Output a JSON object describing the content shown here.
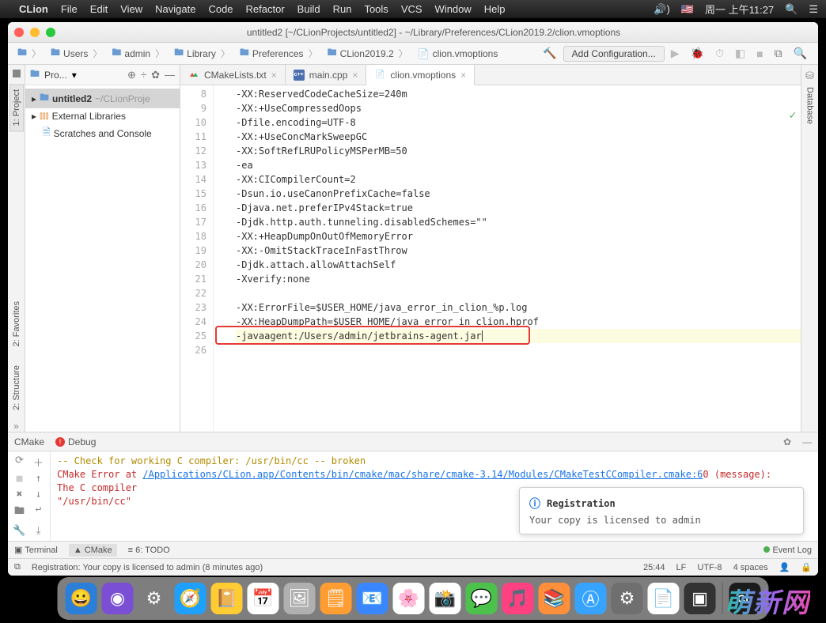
{
  "menubar": {
    "app": "CLion",
    "items": [
      "File",
      "Edit",
      "View",
      "Navigate",
      "Code",
      "Refactor",
      "Build",
      "Run",
      "Tools",
      "VCS",
      "Window",
      "Help"
    ],
    "clock": "周一 上午11:27"
  },
  "window": {
    "title": "untitled2 [~/CLionProjects/untitled2] - ~/Library/Preferences/CLion2019.2/clion.vmoptions"
  },
  "breadcrumbs": [
    "Users",
    "admin",
    "Library",
    "Preferences",
    "CLion2019.2",
    "clion.vmoptions"
  ],
  "toolbar": {
    "add_config": "Add Configuration..."
  },
  "project_pane": {
    "title": "Pro...",
    "items": [
      {
        "name": "untitled2",
        "path": "~/CLionProje",
        "selected": true
      },
      {
        "name": "External Libraries"
      },
      {
        "name": "Scratches and Console"
      }
    ]
  },
  "left_vtabs": [
    "1: Project",
    "2: Favorites",
    "2: Structure"
  ],
  "right_vtabs": [
    "Database"
  ],
  "editor_tabs": [
    {
      "label": "CMakeLists.txt",
      "icon_color": "multi"
    },
    {
      "label": "main.cpp",
      "icon_text": "c++",
      "icon_color": "#4b6eaf"
    },
    {
      "label": "clion.vmoptions",
      "active": true,
      "icon_color": "#888"
    }
  ],
  "editor": {
    "first_line_no": 8,
    "lines": [
      "-XX:ReservedCodeCacheSize=240m",
      "-XX:+UseCompressedOops",
      "-Dfile.encoding=UTF-8",
      "-XX:+UseConcMarkSweepGC",
      "-XX:SoftRefLRUPolicyMSPerMB=50",
      "-ea",
      "-XX:CICompilerCount=2",
      "-Dsun.io.useCanonPrefixCache=false",
      "-Djava.net.preferIPv4Stack=true",
      "-Djdk.http.auth.tunneling.disabledSchemes=\"\"",
      "-XX:+HeapDumpOnOutOfMemoryError",
      "-XX:-OmitStackTraceInFastThrow",
      "-Djdk.attach.allowAttachSelf",
      "-Xverify:none",
      "",
      "-XX:ErrorFile=$USER_HOME/java_error_in_clion_%p.log",
      "-XX:HeapDumpPath=$USER_HOME/java_error_in_clion.hprof",
      "-javaagent:/Users/admin/jetbrains-agent.jar",
      ""
    ],
    "highlighted_line_index": 17
  },
  "cmake_panel": {
    "tabs": {
      "cmake": "CMake",
      "debug": "Debug"
    },
    "lines": [
      {
        "text": "-- Check for working C compiler: /usr/bin/cc -- broken",
        "color": "#b28b00"
      },
      {
        "prefix": "CMake Error at ",
        "prefix_color": "#c62828",
        "link": "/Applications/CLion.app/Contents/bin/cmake/mac/share/cmake-3.14/Modules/CMakeTestCCompiler.cmake:6",
        "suffix": "0 (message):"
      },
      {
        "text": "  The C compiler",
        "color": "#c62828"
      },
      {
        "text": ""
      },
      {
        "text": "    \"/usr/bin/cc\"",
        "color": "#c62828"
      }
    ],
    "popup": {
      "title": "Registration",
      "body": "Your copy is licensed to admin"
    }
  },
  "bottom_tabs": {
    "terminal": "Terminal",
    "cmake": "CMake",
    "todo": "6: TODO",
    "eventlog": "Event Log"
  },
  "status_bar": {
    "msg": "Registration: Your copy is licensed to admin (8 minutes ago)",
    "pos": "25:44",
    "eol": "LF",
    "enc": "UTF-8",
    "indent": "4 spaces"
  },
  "dock_apps": [
    {
      "bg": "#2b7fd9",
      "emoji": "😀"
    },
    {
      "bg": "#7a4fd4",
      "emoji": "◉"
    },
    {
      "bg": "#7e7e7e",
      "emoji": "⚙"
    },
    {
      "bg": "#1ea0ff",
      "emoji": "🧭"
    },
    {
      "bg": "#ffcc33",
      "emoji": "📔"
    },
    {
      "bg": "#fff",
      "emoji": "📅"
    },
    {
      "bg": "#b0b0b0",
      "emoji": "🖼"
    },
    {
      "bg": "#ff9d33",
      "emoji": "🗒"
    },
    {
      "bg": "#3a86ff",
      "emoji": "📧"
    },
    {
      "bg": "#fff",
      "emoji": "🌸"
    },
    {
      "bg": "#fff",
      "emoji": "📸"
    },
    {
      "bg": "#4cc24c",
      "emoji": "💬"
    },
    {
      "bg": "#ff4081",
      "emoji": "🎵"
    },
    {
      "bg": "#ff8f3a",
      "emoji": "📚"
    },
    {
      "bg": "#36a4ff",
      "emoji": "Ⓐ"
    },
    {
      "bg": "#6f6f6f",
      "emoji": "⚙"
    },
    {
      "bg": "#fff",
      "emoji": "📄"
    },
    {
      "bg": "#333",
      "emoji": "▣"
    },
    {
      "bg": "#1b1b1b",
      "emoji": "CL"
    }
  ],
  "brand": "萌新网"
}
